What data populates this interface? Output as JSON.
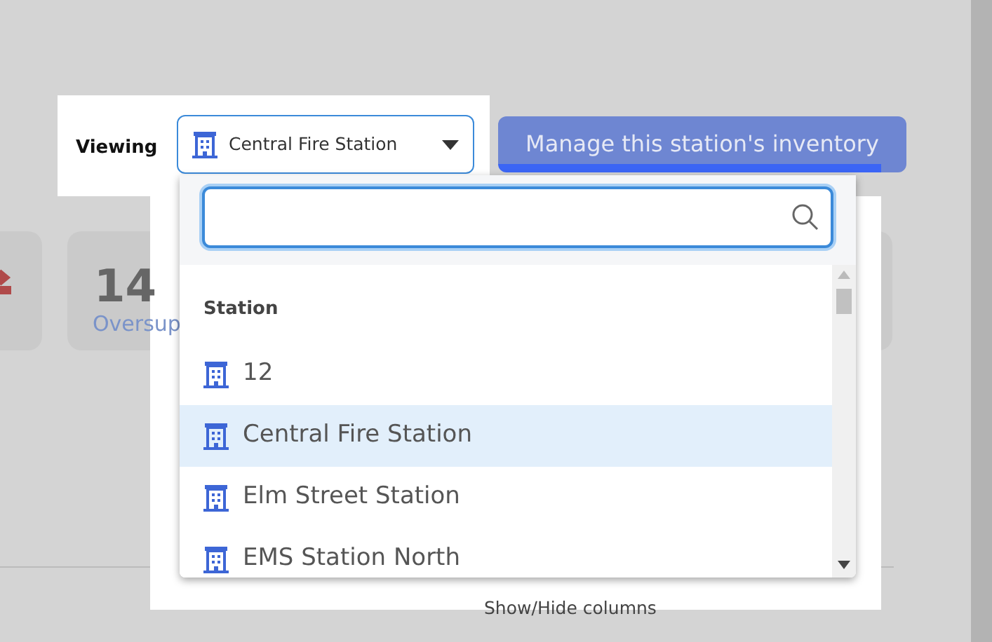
{
  "viewing": {
    "label": "Viewing",
    "value": "Central Fire Station"
  },
  "manage_button": {
    "label": "Manage this station's inventory",
    "disabled": true
  },
  "stat_cards": [
    {
      "value": "14",
      "label": "Oversup"
    }
  ],
  "dropdown": {
    "group_label": "Station",
    "options": [
      {
        "label": "12",
        "selected": false
      },
      {
        "label": "Central Fire Station",
        "selected": true
      },
      {
        "label": "Elm Street Station",
        "selected": false
      },
      {
        "label": "EMS Station North",
        "selected": false
      }
    ]
  },
  "footer_link": "Show/Hide columns"
}
